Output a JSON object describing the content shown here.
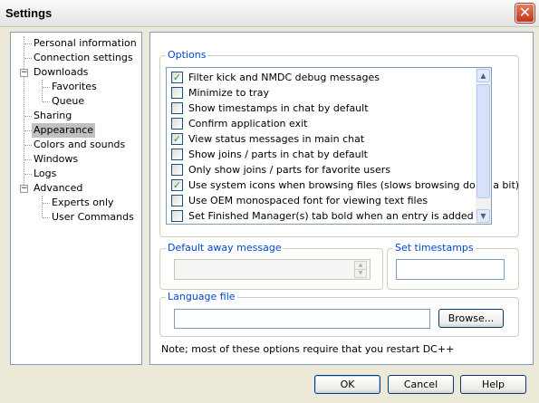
{
  "window": {
    "title": "Settings",
    "close_glyph": "✕"
  },
  "tree": {
    "items": [
      {
        "label": "Personal information"
      },
      {
        "label": "Connection settings"
      },
      {
        "label": "Downloads",
        "expander": "−"
      },
      {
        "label": "Favorites"
      },
      {
        "label": "Queue"
      },
      {
        "label": "Sharing"
      },
      {
        "label": "Appearance",
        "selected": true
      },
      {
        "label": "Colors and sounds"
      },
      {
        "label": "Windows"
      },
      {
        "label": "Logs"
      },
      {
        "label": "Advanced",
        "expander": "−"
      },
      {
        "label": "Experts only"
      },
      {
        "label": "User Commands"
      }
    ]
  },
  "options": {
    "group_label": "Options",
    "items": [
      {
        "label": "Filter kick and NMDC debug messages",
        "checked": true
      },
      {
        "label": "Minimize to tray",
        "checked": false
      },
      {
        "label": "Show timestamps in chat by default",
        "checked": false
      },
      {
        "label": "Confirm application exit",
        "checked": false
      },
      {
        "label": "View status messages in main chat",
        "checked": true
      },
      {
        "label": "Show joins / parts in chat by default",
        "checked": false
      },
      {
        "label": "Only show joins / parts for favorite users",
        "checked": false
      },
      {
        "label": "Use system icons when browsing files (slows browsing down a bit)",
        "checked": true
      },
      {
        "label": "Use OEM monospaced font for viewing text files",
        "checked": false
      },
      {
        "label": "Set Finished Manager(s) tab bold when an entry is added",
        "checked": false
      }
    ],
    "check_glyph": "✓",
    "scroll_up_glyph": "▲",
    "scroll_down_glyph": "▼"
  },
  "away": {
    "group_label": "Default away message",
    "value": "",
    "spin_up_glyph": "▲",
    "spin_down_glyph": "▼"
  },
  "timestamps": {
    "group_label": "Set timestamps",
    "value": ""
  },
  "language": {
    "group_label": "Language file",
    "value": "",
    "browse_label": "Browse..."
  },
  "note": "Note; most of these options require that you restart DC++",
  "buttons": {
    "ok": "OK",
    "cancel": "Cancel",
    "help": "Help"
  },
  "colors": {
    "group_label": "#0046d5",
    "check": "#21a121",
    "close_button": "#c0381c",
    "selection": "#c0c0c0"
  }
}
